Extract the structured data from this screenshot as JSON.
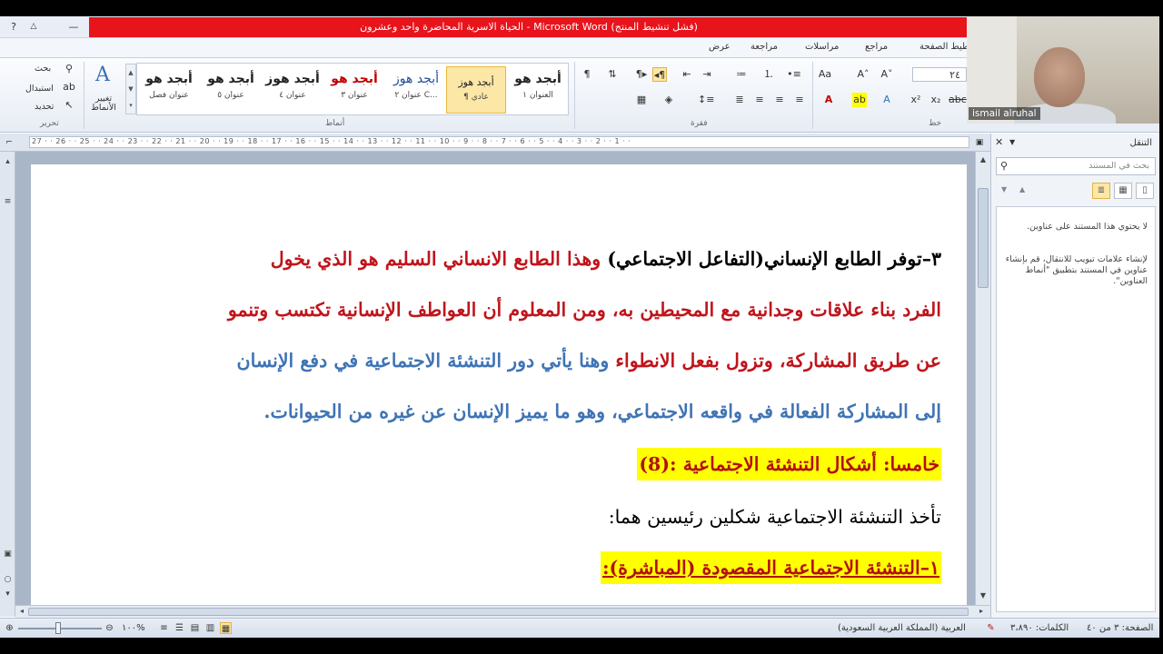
{
  "window": {
    "title": "الحياة الاسرية المحاضرة واحد وعشرون - Microsoft Word (فشل تنشيط المنتج)",
    "help_glyph": "?",
    "minimize_glyph": "—",
    "ribbon_toggle_glyph": "△"
  },
  "tabs": [
    "تخطيط الصفحة",
    "مراجع",
    "مراسلات",
    "مراجعة",
    "عرض"
  ],
  "ribbon": {
    "groups": {
      "editing": "تحرير",
      "styles": "أنماط",
      "paragraph": "فقرة",
      "font": "خط"
    },
    "editing": {
      "find": "بحث",
      "replace": "استبدال",
      "select": "تحديد"
    },
    "change_styles": "تغيير الأنماط",
    "font_size": "٢٤",
    "styles": [
      {
        "sample": "أبجد هو",
        "name": "عنوان فصل",
        "color": "#000000"
      },
      {
        "sample": "أبجد هو",
        "name": "عنوان ٥",
        "color": "#000000"
      },
      {
        "sample": "أبجد هوز",
        "name": "عنوان ٤",
        "color": "#000000"
      },
      {
        "sample": "أبجد هو",
        "name": "عنوان ٣",
        "color": "#c00000"
      },
      {
        "sample": "أبجد هوز",
        "name": "عنوان ٢ C...",
        "color": "#1f4e9a"
      },
      {
        "sample": "أبجد هوز",
        "name": "¶ عادي",
        "color": "#000000",
        "selected": true
      },
      {
        "sample": "أبجد هو",
        "name": "العنوان ١",
        "color": "#000000"
      }
    ]
  },
  "ruler": {
    "numbers": "27 · · 26 · · 25 · · 24 · · 23 · · 22 · · 21 · · 20 · · 19 · · 18 · · 17 · · 16 · · 15 · · 14 · · 13 · · 12 · · 11 · · 10 · · 9 · · 8 · · 7 · · 6 · · 5 · · 4 · · 3 · · 2 · · 1 · ·"
  },
  "document": {
    "p1": {
      "a": "٣–توفر الطابع الإنساني(التفاعل الاجتماعي)",
      "b": " وهذا الطابع الانساني السليم هو الذي يخول"
    },
    "p2": "الفرد بناء علاقات وجدانية مع المحيطين به، ومن المعلوم أن العواطف الإنسانية تكتسب وتنمو",
    "p3": {
      "a": "عن طريق المشاركة، وتزول بفعل الانطواء",
      "b": " وهنا يأتي دور التنشئة الاجتماعية في دفع الإنسان"
    },
    "p4": "إلى المشاركة الفعالة في واقعه الاجتماعي، وهو ما يميز الإنسان عن غيره من الحيوانات.",
    "p5": "خامسا: أشكال التنشئة الاجتماعية :(8)",
    "p6": "تأخذ التنشئة الاجتماعية شكلين رئيسين هما:",
    "p7": "١–التنشئة الاجتماعية المقصودة (المباشرة):"
  },
  "colors": {
    "black": "#000000",
    "red": "#c0141b",
    "blue": "#3f74b5",
    "darkred": "#b31010",
    "highlight": "#ffff00"
  },
  "nav": {
    "title": "التنقل",
    "search_placeholder": "بحث في المستند",
    "msg1": "لا يحتوي هذا المستند على عناوين.",
    "msg2": "لإنشاء علامات تبويب للانتقال، قم بإنشاء عناوين في المستند بتطبيق \"أنماط العناوين\"."
  },
  "status": {
    "page": "الصفحة: ٣ من ٤٠",
    "words": "الكلمات: ٣،٨٩٠",
    "language": "العربية (المملكة العربية السعودية)",
    "zoom": "١٠٠%"
  },
  "webcam": {
    "name": "ismail alruhal"
  }
}
